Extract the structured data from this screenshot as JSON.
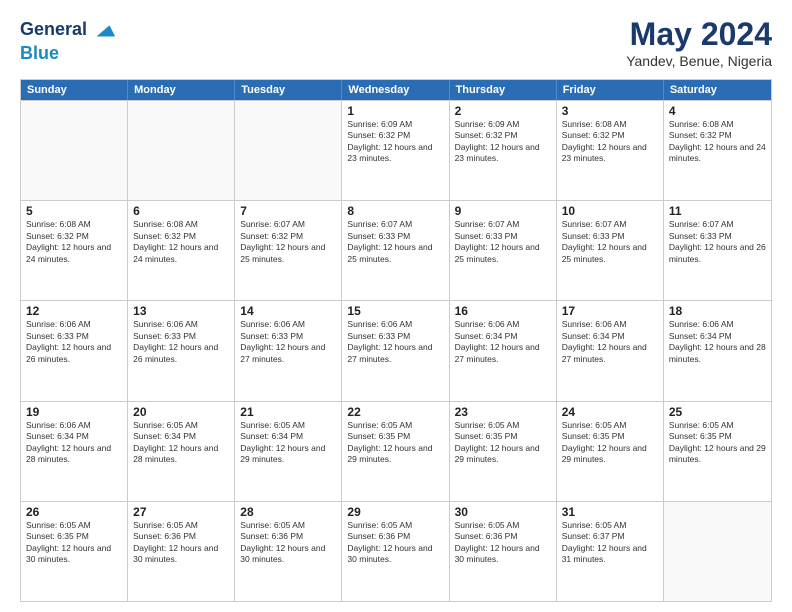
{
  "header": {
    "logo_line1": "General",
    "logo_line2": "Blue",
    "title": "May 2024",
    "subtitle": "Yandev, Benue, Nigeria"
  },
  "calendar": {
    "days_of_week": [
      "Sunday",
      "Monday",
      "Tuesday",
      "Wednesday",
      "Thursday",
      "Friday",
      "Saturday"
    ],
    "rows": [
      [
        {
          "day": "",
          "empty": true
        },
        {
          "day": "",
          "empty": true
        },
        {
          "day": "",
          "empty": true
        },
        {
          "day": "1",
          "sunrise": "6:09 AM",
          "sunset": "6:32 PM",
          "daylight": "12 hours and 23 minutes."
        },
        {
          "day": "2",
          "sunrise": "6:09 AM",
          "sunset": "6:32 PM",
          "daylight": "12 hours and 23 minutes."
        },
        {
          "day": "3",
          "sunrise": "6:08 AM",
          "sunset": "6:32 PM",
          "daylight": "12 hours and 23 minutes."
        },
        {
          "day": "4",
          "sunrise": "6:08 AM",
          "sunset": "6:32 PM",
          "daylight": "12 hours and 24 minutes."
        }
      ],
      [
        {
          "day": "5",
          "sunrise": "6:08 AM",
          "sunset": "6:32 PM",
          "daylight": "12 hours and 24 minutes."
        },
        {
          "day": "6",
          "sunrise": "6:08 AM",
          "sunset": "6:32 PM",
          "daylight": "12 hours and 24 minutes."
        },
        {
          "day": "7",
          "sunrise": "6:07 AM",
          "sunset": "6:32 PM",
          "daylight": "12 hours and 25 minutes."
        },
        {
          "day": "8",
          "sunrise": "6:07 AM",
          "sunset": "6:33 PM",
          "daylight": "12 hours and 25 minutes."
        },
        {
          "day": "9",
          "sunrise": "6:07 AM",
          "sunset": "6:33 PM",
          "daylight": "12 hours and 25 minutes."
        },
        {
          "day": "10",
          "sunrise": "6:07 AM",
          "sunset": "6:33 PM",
          "daylight": "12 hours and 25 minutes."
        },
        {
          "day": "11",
          "sunrise": "6:07 AM",
          "sunset": "6:33 PM",
          "daylight": "12 hours and 26 minutes."
        }
      ],
      [
        {
          "day": "12",
          "sunrise": "6:06 AM",
          "sunset": "6:33 PM",
          "daylight": "12 hours and 26 minutes."
        },
        {
          "day": "13",
          "sunrise": "6:06 AM",
          "sunset": "6:33 PM",
          "daylight": "12 hours and 26 minutes."
        },
        {
          "day": "14",
          "sunrise": "6:06 AM",
          "sunset": "6:33 PM",
          "daylight": "12 hours and 27 minutes."
        },
        {
          "day": "15",
          "sunrise": "6:06 AM",
          "sunset": "6:33 PM",
          "daylight": "12 hours and 27 minutes."
        },
        {
          "day": "16",
          "sunrise": "6:06 AM",
          "sunset": "6:34 PM",
          "daylight": "12 hours and 27 minutes."
        },
        {
          "day": "17",
          "sunrise": "6:06 AM",
          "sunset": "6:34 PM",
          "daylight": "12 hours and 27 minutes."
        },
        {
          "day": "18",
          "sunrise": "6:06 AM",
          "sunset": "6:34 PM",
          "daylight": "12 hours and 28 minutes."
        }
      ],
      [
        {
          "day": "19",
          "sunrise": "6:06 AM",
          "sunset": "6:34 PM",
          "daylight": "12 hours and 28 minutes."
        },
        {
          "day": "20",
          "sunrise": "6:05 AM",
          "sunset": "6:34 PM",
          "daylight": "12 hours and 28 minutes."
        },
        {
          "day": "21",
          "sunrise": "6:05 AM",
          "sunset": "6:34 PM",
          "daylight": "12 hours and 29 minutes."
        },
        {
          "day": "22",
          "sunrise": "6:05 AM",
          "sunset": "6:35 PM",
          "daylight": "12 hours and 29 minutes."
        },
        {
          "day": "23",
          "sunrise": "6:05 AM",
          "sunset": "6:35 PM",
          "daylight": "12 hours and 29 minutes."
        },
        {
          "day": "24",
          "sunrise": "6:05 AM",
          "sunset": "6:35 PM",
          "daylight": "12 hours and 29 minutes."
        },
        {
          "day": "25",
          "sunrise": "6:05 AM",
          "sunset": "6:35 PM",
          "daylight": "12 hours and 29 minutes."
        }
      ],
      [
        {
          "day": "26",
          "sunrise": "6:05 AM",
          "sunset": "6:35 PM",
          "daylight": "12 hours and 30 minutes."
        },
        {
          "day": "27",
          "sunrise": "6:05 AM",
          "sunset": "6:36 PM",
          "daylight": "12 hours and 30 minutes."
        },
        {
          "day": "28",
          "sunrise": "6:05 AM",
          "sunset": "6:36 PM",
          "daylight": "12 hours and 30 minutes."
        },
        {
          "day": "29",
          "sunrise": "6:05 AM",
          "sunset": "6:36 PM",
          "daylight": "12 hours and 30 minutes."
        },
        {
          "day": "30",
          "sunrise": "6:05 AM",
          "sunset": "6:36 PM",
          "daylight": "12 hours and 30 minutes."
        },
        {
          "day": "31",
          "sunrise": "6:05 AM",
          "sunset": "6:37 PM",
          "daylight": "12 hours and 31 minutes."
        },
        {
          "day": "",
          "empty": true
        }
      ]
    ]
  }
}
